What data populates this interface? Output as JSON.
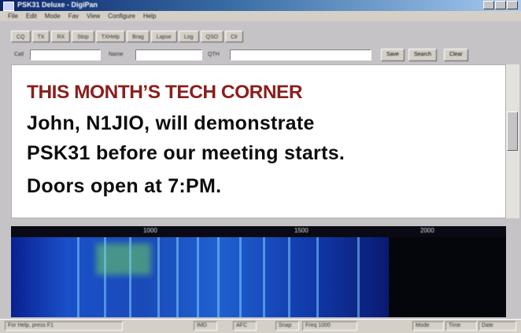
{
  "window": {
    "title": "PSK31 Deluxe - DigiPan",
    "menu": [
      "File",
      "Edit",
      "Mode",
      "Fav",
      "View",
      "Configure",
      "Help"
    ]
  },
  "toolbar": {
    "buttons": [
      "CQ",
      "TX",
      "RX",
      "Stop",
      "TXHelp",
      "Brag",
      "Lapse",
      "Log",
      "QSO",
      "Clr"
    ]
  },
  "fields": {
    "call_label": "Call",
    "name_label": "Name",
    "qth_label": "QTH",
    "buttons": [
      "Save",
      "Search",
      "Clear"
    ]
  },
  "overlay": {
    "title": "THIS MONTH’S TECH CORNER",
    "line1": "John, N1JIO, will demonstrate",
    "line2": "PSK31 before our meeting starts.",
    "line3": "Doors open at 7:PM."
  },
  "spectrum": {
    "labels": [
      "1000",
      "1500",
      "2000"
    ]
  },
  "status": {
    "cells": [
      "For Help, press F1",
      "IMD",
      "AFC",
      "Snap",
      "Freq 1000",
      "Mode",
      "Time",
      "Date"
    ]
  },
  "colors": {
    "title_red": "#8b1e1b",
    "text_black": "#0d0d0d",
    "waterfall_blue": "#1a50c8"
  }
}
